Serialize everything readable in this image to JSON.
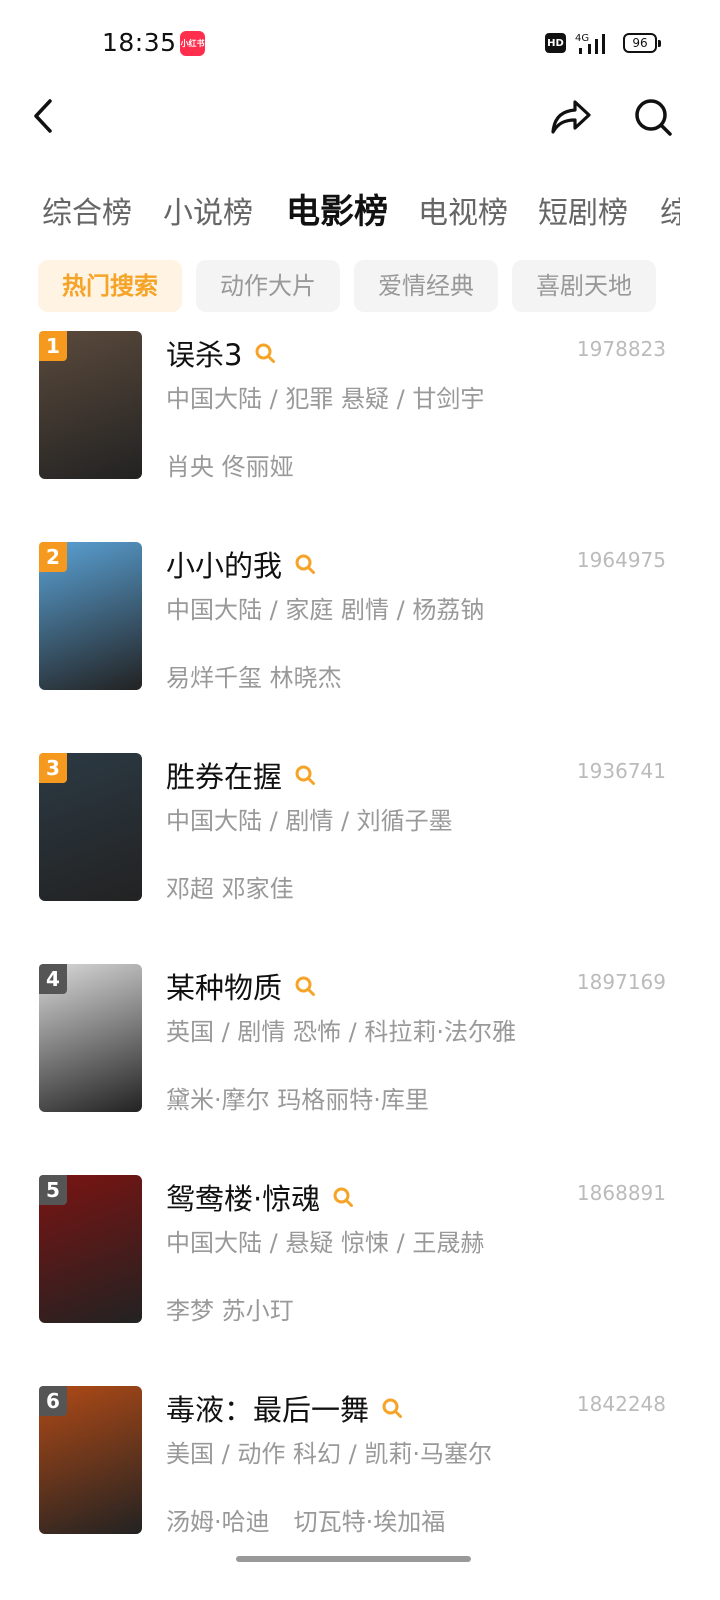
{
  "status_bar": {
    "time": "18:35",
    "app_badge": "小红书",
    "hd_label": "HD",
    "network_label": "4G",
    "battery": "96"
  },
  "nav": {
    "back_icon": "chevron-left-icon",
    "share_icon": "share-arrow-icon",
    "search_icon": "search-icon"
  },
  "tabs": [
    {
      "label": "综合榜",
      "active": false
    },
    {
      "label": "小说榜",
      "active": false
    },
    {
      "label": "电影榜",
      "active": true
    },
    {
      "label": "电视榜",
      "active": false
    },
    {
      "label": "短剧榜",
      "active": false
    },
    {
      "label": "综",
      "active": false
    }
  ],
  "chips": [
    {
      "label": "热门搜索",
      "active": true
    },
    {
      "label": "动作大片",
      "active": false
    },
    {
      "label": "爱情经典",
      "active": false
    },
    {
      "label": "喜剧天地",
      "active": false
    }
  ],
  "colors": {
    "accent": "#f5a428",
    "rank_top": "#f59a1f",
    "rank_other": "#555555"
  },
  "movies": [
    {
      "rank": "1",
      "title": "误杀3",
      "count": "1978823",
      "meta": "中国大陆 / 犯罪 悬疑 / 甘剑宇",
      "cast": "肖央 佟丽娅",
      "poster_color": "#5b4a3c"
    },
    {
      "rank": "2",
      "title": "小小的我",
      "count": "1964975",
      "meta": "中国大陆 / 家庭 剧情 / 杨荔钠",
      "cast": "易烊千玺 林晓杰",
      "poster_color": "#5aa2d6"
    },
    {
      "rank": "3",
      "title": "胜券在握",
      "count": "1936741",
      "meta": "中国大陆 / 剧情 / 刘循子墨",
      "cast": "邓超 邓家佳",
      "poster_color": "#2c3a44"
    },
    {
      "rank": "4",
      "title": "某种物质",
      "count": "1897169",
      "meta": "英国 / 剧情 恐怖 / 科拉莉·法尔雅",
      "cast": "黛米·摩尔 玛格丽特·库里",
      "poster_color": "#d9d9d9"
    },
    {
      "rank": "5",
      "title": "鸳鸯楼·惊魂",
      "count": "1868891",
      "meta": "中国大陆 / 悬疑 惊悚 / 王晟赫",
      "cast": "李梦 苏小玎",
      "poster_color": "#7a1412"
    },
    {
      "rank": "6",
      "title": "毒液：最后一舞",
      "count": "1842248",
      "meta": "美国 / 动作 科幻 / 凯莉·马塞尔",
      "cast": "汤姆·哈迪　切瓦特·埃加福",
      "poster_color": "#b04a16"
    }
  ]
}
